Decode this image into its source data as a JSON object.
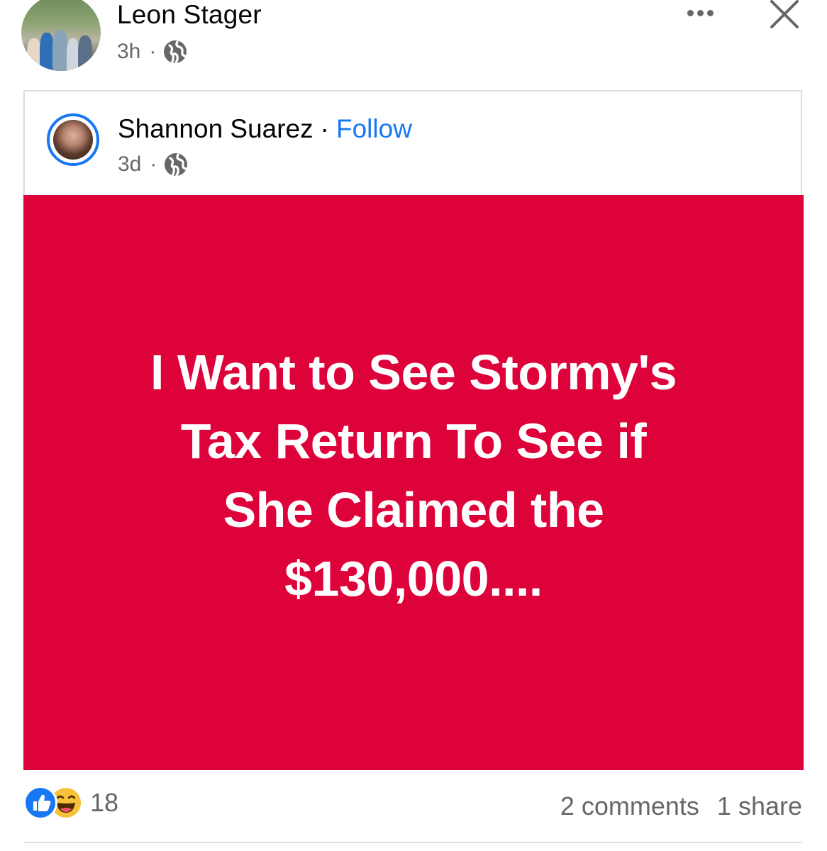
{
  "post": {
    "author_name": "Leon Stager",
    "timestamp": "3h",
    "separator": "·",
    "privacy_icon": "globe-icon",
    "more_icon": "more-horizontal-icon",
    "close_icon": "close-icon"
  },
  "shared_post": {
    "author_name": "Shannon Suarez",
    "separator": "·",
    "follow_label": "Follow",
    "timestamp": "3d",
    "privacy_icon": "globe-icon",
    "background_color": "#dd0239",
    "body_lines": [
      "I Want to See Stormy's",
      "Tax Return To See if",
      "She Claimed the",
      "$130,000...."
    ]
  },
  "engagement": {
    "reaction_icons": [
      "like-icon",
      "haha-icon"
    ],
    "reaction_count": "18",
    "comments": "2 comments",
    "shares": "1 share"
  },
  "colors": {
    "link_blue": "#1877f2",
    "secondary_text": "#65676b",
    "post_red": "#dd0239"
  }
}
